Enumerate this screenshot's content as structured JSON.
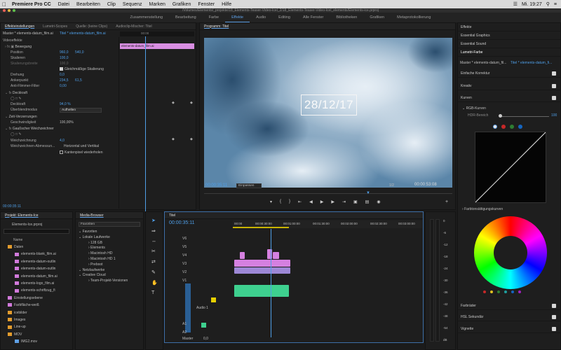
{
  "menubar": {
    "app": "Premiere Pro CC",
    "items": [
      "Datei",
      "Bearbeiten",
      "Clip",
      "Sequenz",
      "Marken",
      "Grafiken",
      "Fenster",
      "Hilfe"
    ],
    "clock": "Mi. 19:27"
  },
  "window_title": "/Volumes/Elements/_projekte/18_Elements-Teaser-Video-Icel_2/18_Elements-Teaser-Video-Icel_elements/Elements-ice.prproj",
  "workspaces": [
    "Zusammenstellung",
    "Bearbeitung",
    "Farbe",
    "Effekte",
    "Audio",
    "Editing",
    "Alle Fenster",
    "Bibliotheken",
    "Grafiken",
    "Metaprotokollierung"
  ],
  "workspace_active": "Effekte",
  "effect_controls": {
    "tabs": [
      "Effekteinstellungen",
      "Lumetri-Scopes",
      "Quelle: (keine Clips)",
      "Audioclip-Mischer: Titel"
    ],
    "master": "Master * elements-datum_film.ai",
    "clip_link": "Titel * elements-datum_film.ai",
    "timeline_clip": "elements-datum_film.ai",
    "ruler_time": "00:00",
    "section_video": "Videoeffekte",
    "rows": [
      {
        "label": "Bewegung",
        "value": "",
        "value2": ""
      },
      {
        "label": "Position",
        "value": "960,0",
        "value2": "540,0"
      },
      {
        "label": "Skalieren",
        "value": "100,0",
        "value2": ""
      },
      {
        "label": "Skalierungsbreite",
        "value": "100,0",
        "value2": ""
      },
      {
        "label": "Gleichmäßige Skalierung",
        "value": "",
        "value2": ""
      },
      {
        "label": "Drehung",
        "value": "0,0",
        "value2": ""
      },
      {
        "label": "Ankerpunkt",
        "value": "234,5",
        "value2": "61,5"
      },
      {
        "label": "Anti-Flimmer-Filter",
        "value": "0,00",
        "value2": ""
      },
      {
        "label": "Deckkraft",
        "value": "",
        "value2": ""
      },
      {
        "label": "Deckkraft",
        "value": "94,0 %",
        "value2": ""
      },
      {
        "label": "Überblendmodus",
        "value": "Aufhellen",
        "value2": ""
      },
      {
        "label": "Zeit-Verzerrungen",
        "value": "",
        "value2": ""
      },
      {
        "label": "Geschwindigkeit",
        "value": "100,00%",
        "value2": ""
      },
      {
        "label": "Gaußscher Weichzeichner",
        "value": "",
        "value2": ""
      },
      {
        "label": "Weichzeichnung",
        "value": "4,0",
        "value2": ""
      },
      {
        "label": "Weichzeichnen-Abmessun...",
        "value": "Horizontal und Vertikal",
        "value2": ""
      },
      {
        "label": "Kantenpixel wiederholen",
        "value": "",
        "value2": ""
      }
    ],
    "timecode": "00:00:35:11"
  },
  "program": {
    "title": "Programm: Titel",
    "overlay_text": "28/12/17",
    "timecode": "00:00:35:11",
    "fit": "Einpassen",
    "quality": "1/2",
    "duration": "00:00:53:08"
  },
  "lumetri": {
    "tabs": [
      "Effekte",
      "Essential Graphics",
      "Essential Sound",
      "Lumetri-Farbe"
    ],
    "master": "Master * elements-datum_fil...",
    "clip": "Titel * elements-datum_fi...",
    "rows": [
      "Einfache Korrektur",
      "Kreativ",
      "Kurven"
    ],
    "rgb_curves": "RGB-Kurven",
    "hdr": "HDR-Bereich",
    "hdr_value": "100",
    "hue_section": "Farbtonsättigungskurven",
    "bottom_rows": [
      "Farbräder",
      "HSL Sekundär",
      "Vignette"
    ],
    "dot_colors": [
      "#e8e8e8",
      "#c62828",
      "#2e7d32",
      "#1565c0"
    ]
  },
  "project": {
    "title": "Projekt: Elements-Ice",
    "file": "Elements-Ice.prproj",
    "column": "Name",
    "items": [
      {
        "name": "Daten",
        "color": "#e39c2d",
        "indent": 1
      },
      {
        "name": "elements-blank_film.ai",
        "color": "#d17adb",
        "indent": 2
      },
      {
        "name": "elements-datum-outlin",
        "color": "#d17adb",
        "indent": 2
      },
      {
        "name": "elements-datum-outlin",
        "color": "#d17adb",
        "indent": 2
      },
      {
        "name": "elements-datum_film.ai",
        "color": "#d17adb",
        "indent": 2
      },
      {
        "name": "elements-logo_film.ai",
        "color": "#d17adb",
        "indent": 2
      },
      {
        "name": "elements-schriftzug_fi",
        "color": "#d17adb",
        "indent": 2
      },
      {
        "name": "Einstellungsebene",
        "color": "#d17adb",
        "indent": 1
      },
      {
        "name": "Farbfläche-weiß",
        "color": "#d17adb",
        "indent": 1
      },
      {
        "name": "icebilder",
        "color": "#e39c2d",
        "indent": 1
      },
      {
        "name": "Images",
        "color": "#e39c2d",
        "indent": 1
      },
      {
        "name": "Line-up",
        "color": "#e39c2d",
        "indent": 1
      },
      {
        "name": "MOV",
        "color": "#e39c2d",
        "indent": 1
      },
      {
        "name": "IMG2.mov",
        "color": "#5fa0e6",
        "indent": 2
      }
    ]
  },
  "media_browser": {
    "title": "Media-Browser",
    "dropdown": "Favoriten",
    "items": [
      {
        "name": "Favoriten",
        "indent": 0
      },
      {
        "name": "Lokale Laufwerke",
        "indent": 0
      },
      {
        "name": "128 GB",
        "indent": 1
      },
      {
        "name": "Elements",
        "indent": 1
      },
      {
        "name": "Macintosh HD",
        "indent": 1
      },
      {
        "name": "Macintosh HD 1",
        "indent": 1
      },
      {
        "name": "Preboot",
        "indent": 1
      },
      {
        "name": "Netzlaufwerke",
        "indent": 0
      },
      {
        "name": "Creative Cloud",
        "indent": 0
      },
      {
        "name": "Team-Projekt-Versionen",
        "indent": 1
      }
    ]
  },
  "timeline": {
    "tab": "Titel",
    "timecode": "00:00:35:11",
    "ruler": [
      "00:00",
      "00:00:30:00",
      "00:01:00:00",
      "00:01:30:00",
      "00:02:00:00",
      "00:02:30:00",
      "00:03:00:00"
    ],
    "video_tracks": [
      "V6",
      "V5",
      "V4",
      "V3",
      "V2",
      "V1"
    ],
    "audio_tracks": [
      "A1",
      "A2",
      "A3"
    ],
    "audio_label": "Audio 1",
    "master": "Master",
    "master_value": "0,0"
  },
  "meters": {
    "scale": [
      "0",
      "-6",
      "-12",
      "-18",
      "-24",
      "-30",
      "-36",
      "-42",
      "-48",
      "-54",
      "dB"
    ]
  }
}
